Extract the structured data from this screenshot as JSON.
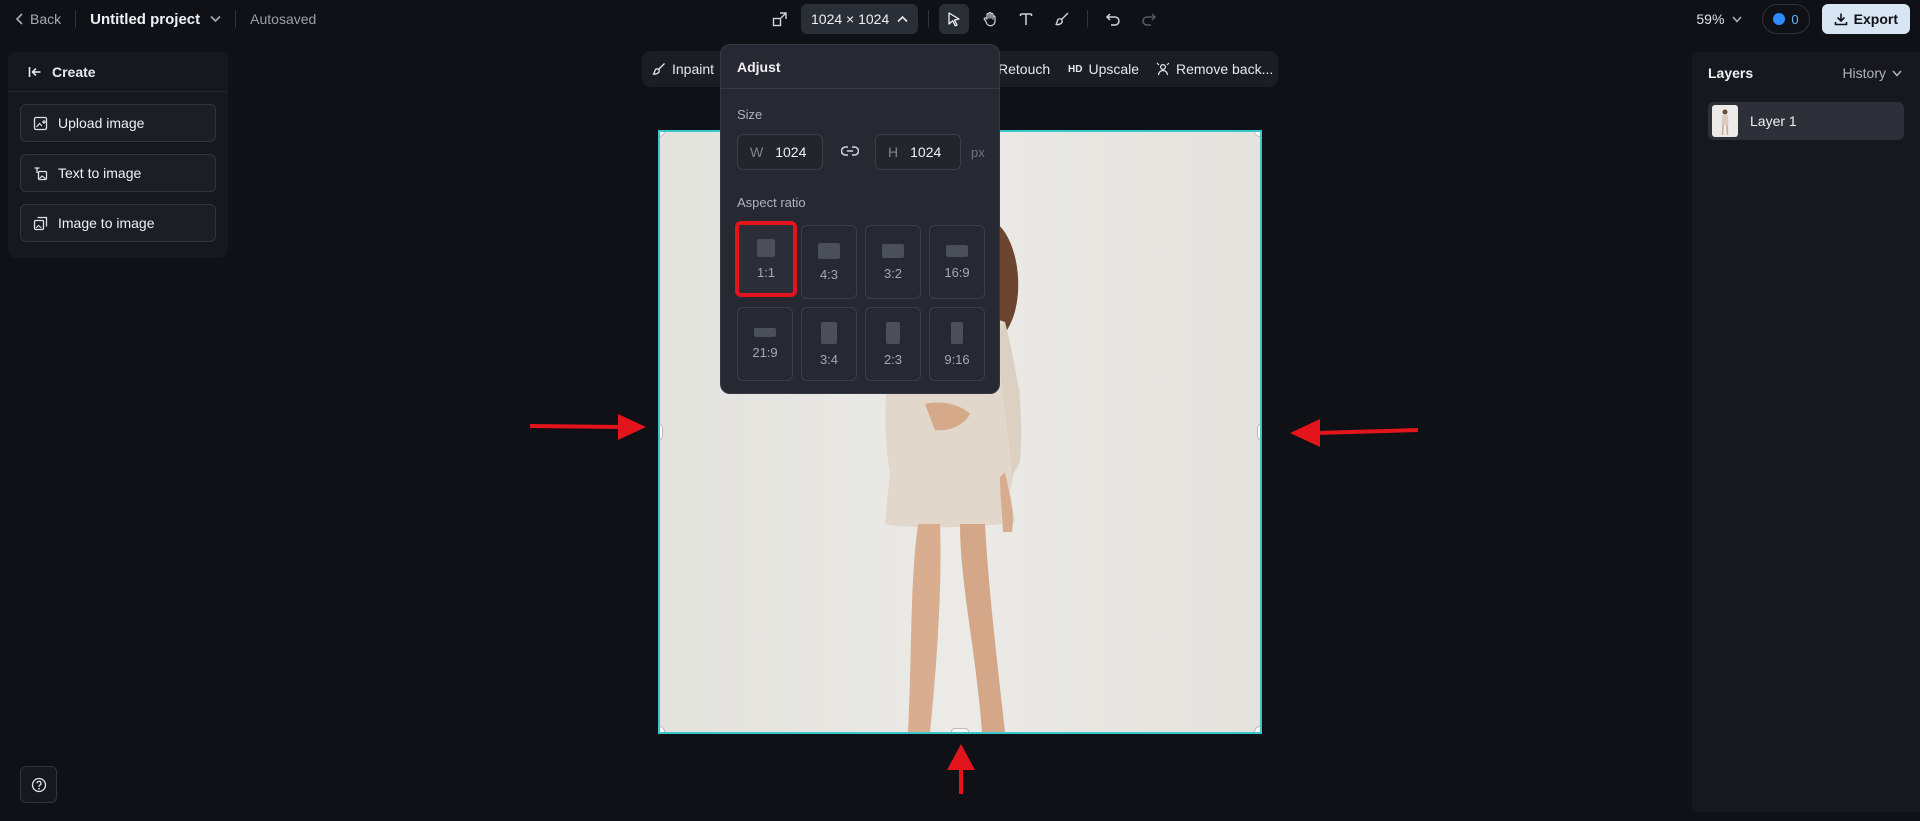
{
  "topbar": {
    "back_label": "Back",
    "project_title": "Untitled project",
    "status": "Autosaved",
    "size_label": "1024 × 1024",
    "zoom": "59%",
    "credits": "0",
    "export_label": "Export"
  },
  "create_panel": {
    "title": "Create",
    "items": [
      {
        "label": "Upload image",
        "icon": "upload-image-icon"
      },
      {
        "label": "Text to image",
        "icon": "text-to-image-icon"
      },
      {
        "label": "Image to image",
        "icon": "image-to-image-icon"
      }
    ]
  },
  "toolrow": {
    "inpaint": "Inpaint",
    "retouch": "Retouch",
    "upscale_badge": "HD",
    "upscale": "Upscale",
    "remove_bg": "Remove back..."
  },
  "adjust": {
    "title": "Adjust",
    "size_label": "Size",
    "width_label": "W",
    "width_value": "1024",
    "height_label": "H",
    "height_value": "1024",
    "unit": "px",
    "aspect_label": "Aspect ratio",
    "ratios": [
      "1:1",
      "4:3",
      "3:2",
      "16:9",
      "21:9",
      "3:4",
      "2:3",
      "9:16"
    ],
    "selected_ratio": "1:1"
  },
  "layers": {
    "title": "Layers",
    "history_label": "History",
    "items": [
      {
        "label": "Layer 1"
      }
    ]
  },
  "colors": {
    "accent": "#3cc6c9",
    "annotation": "#e3141b",
    "background": "#0f1116"
  }
}
